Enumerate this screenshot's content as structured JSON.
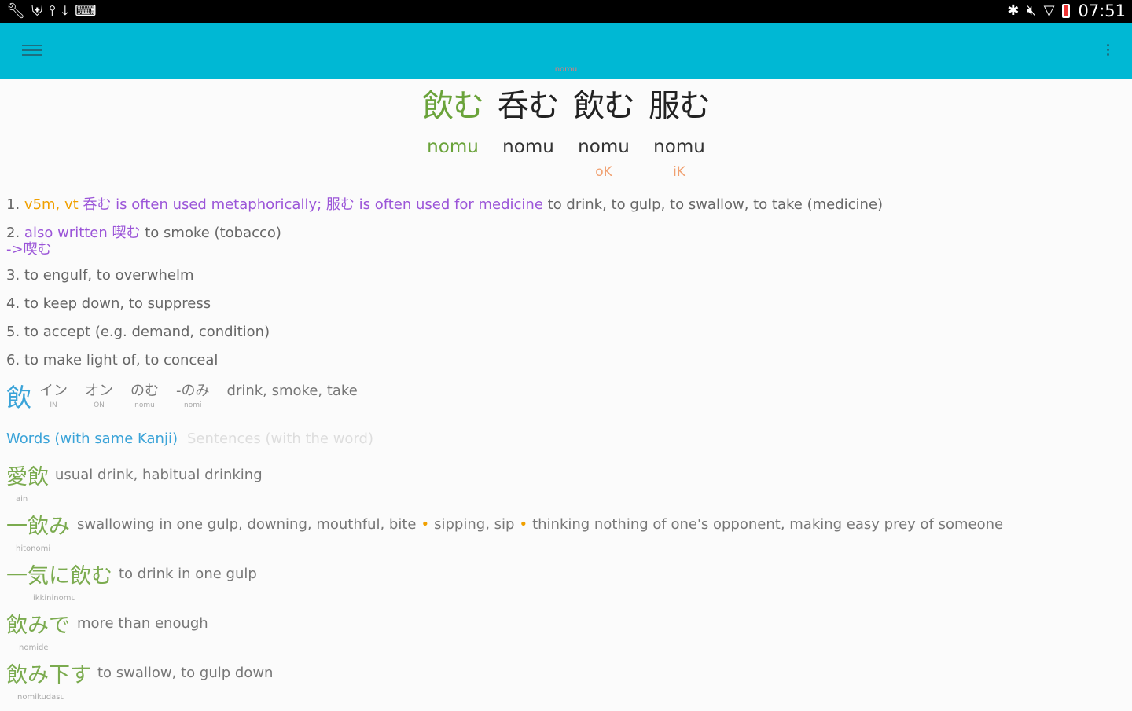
{
  "status_bar": {
    "left_icons": [
      "wrench-icon",
      "shield-icon",
      "usb-icon",
      "download-icon",
      "keyboard-icon"
    ],
    "right_icons": [
      "bluetooth-icon",
      "mute-icon",
      "wifi-icon",
      "battery-icon"
    ],
    "time": "07:51"
  },
  "toolbar": {
    "title": "nomu",
    "menu_icon": "hamburger-icon",
    "overflow_icon": "overflow-menu-icon",
    "color": "#00b8d4"
  },
  "headwords": [
    {
      "kanji": "飲む",
      "reading": "nomu",
      "tag": "",
      "primary": true
    },
    {
      "kanji": "呑む",
      "reading": "nomu",
      "tag": ""
    },
    {
      "kanji": "飲む",
      "reading": "nomu",
      "tag": "oK"
    },
    {
      "kanji": "服む",
      "reading": "nomu",
      "tag": "iK"
    }
  ],
  "senses": [
    {
      "num": "1.",
      "tag": "v5m, vt",
      "note": "呑む is often used metaphorically; 服む is often used for medicine",
      "gloss": "to drink, to gulp, to swallow, to take (medicine)"
    },
    {
      "num": "2.",
      "note": "also written 喫む",
      "gloss": "to smoke (tobacco)",
      "xref": "->喫む"
    },
    {
      "num": "3.",
      "gloss": "to engulf, to overwhelm"
    },
    {
      "num": "4.",
      "gloss": "to keep down, to suppress"
    },
    {
      "num": "5.",
      "gloss": "to accept (e.g. demand, condition)"
    },
    {
      "num": "6.",
      "gloss": "to make light of, to conceal"
    }
  ],
  "kanji_info": {
    "kanji": "飲",
    "readings": [
      {
        "main": "イン",
        "sub": "IN"
      },
      {
        "main": "オン",
        "sub": "ON"
      },
      {
        "main": "のむ",
        "sub": "nomu"
      },
      {
        "main": "-のみ",
        "sub": "nomi"
      }
    ],
    "meaning": "drink, smoke, take"
  },
  "tabs": {
    "words": "Words (with same Kanji)",
    "sentences": "Sentences (with the word)"
  },
  "words": [
    {
      "jp": "愛飲",
      "romaji": "ain",
      "def": "usual drink, habitual drinking"
    },
    {
      "jp": "一飲み",
      "romaji": "hitonomi",
      "defs": [
        "swallowing in one gulp, downing, mouthful, bite",
        "sipping, sip",
        "thinking nothing of one's opponent, making easy prey of someone"
      ]
    },
    {
      "jp": "一気に飲む",
      "romaji": "ikkininomu",
      "def": "to drink in one gulp"
    },
    {
      "jp": "飲みで",
      "romaji": "nomide",
      "def": "more than enough"
    },
    {
      "jp": "飲み下す",
      "romaji": "nomikudasu",
      "def": "to swallow, to gulp down"
    }
  ],
  "colors": {
    "accent": "#00b8d4",
    "headword_green": "#6aa33a",
    "note_purple": "#9b55d8",
    "tag_orange": "#f0a000",
    "kanji_blue": "#3aa3d8"
  }
}
